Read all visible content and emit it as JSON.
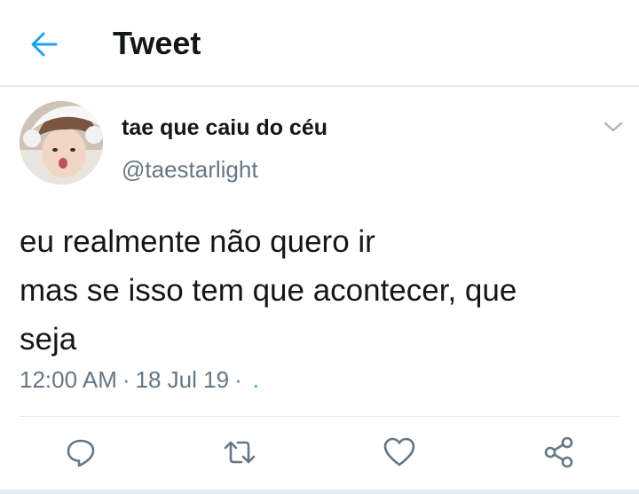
{
  "header": {
    "title": "Tweet",
    "back_icon": "arrow-left-icon",
    "accent": "#1da1f2"
  },
  "tweet": {
    "display_name": "tae que caiu do céu",
    "handle": "@taestarlight",
    "text_lines": [
      "eu realmente não quero ir",
      "mas se isso tem que acontecer, que",
      "seja"
    ],
    "time": "12:00 AM",
    "date": "18 Jul 19",
    "separator": "·",
    "source_dot": "."
  },
  "actions": [
    {
      "name": "reply",
      "icon": "reply-icon"
    },
    {
      "name": "retweet",
      "icon": "retweet-icon"
    },
    {
      "name": "like",
      "icon": "heart-icon"
    },
    {
      "name": "share",
      "icon": "share-icon"
    }
  ],
  "colors": {
    "text": "#14171a",
    "secondary": "#657786",
    "divider": "#e1e8ed"
  }
}
